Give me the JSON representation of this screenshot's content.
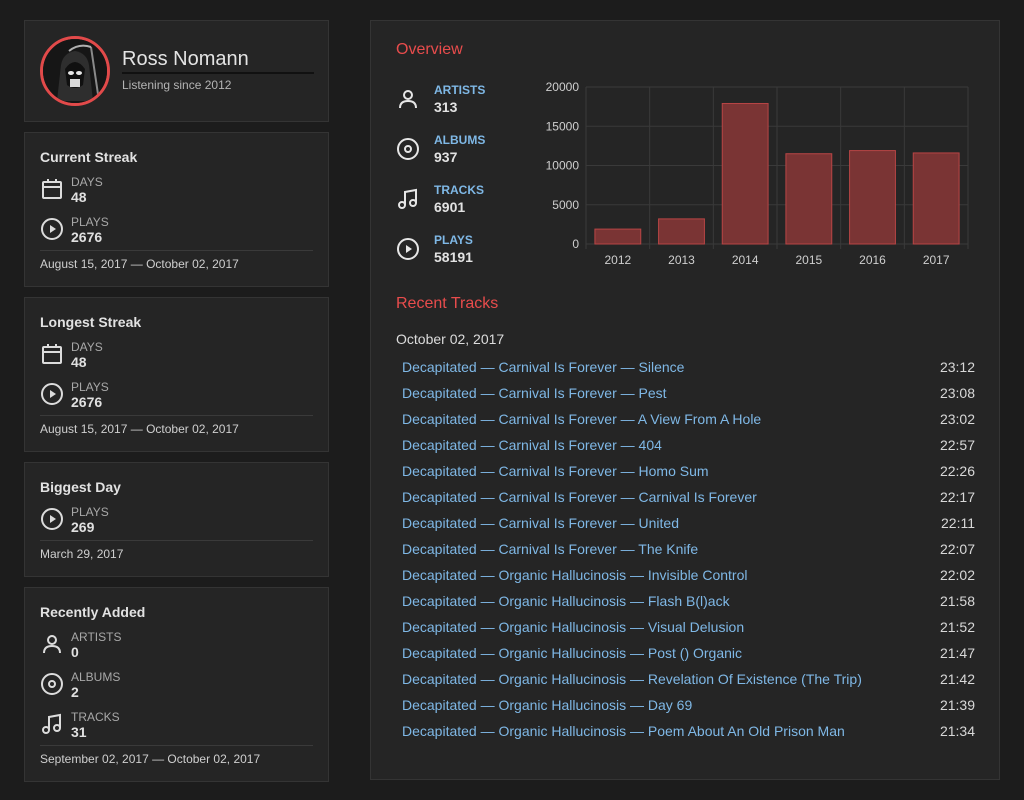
{
  "profile": {
    "name": "Ross Nomann",
    "since": "Listening since 2012"
  },
  "current_streak": {
    "title": "Current Streak",
    "days_label": "DAYS",
    "days": "48",
    "plays_label": "PLAYS",
    "plays": "2676",
    "range": "August 15, 2017 — October 02, 2017"
  },
  "longest_streak": {
    "title": "Longest Streak",
    "days_label": "DAYS",
    "days": "48",
    "plays_label": "PLAYS",
    "plays": "2676",
    "range": "August 15, 2017 — October 02, 2017"
  },
  "biggest_day": {
    "title": "Biggest Day",
    "plays_label": "PLAYS",
    "plays": "269",
    "date": "March 29, 2017"
  },
  "recently_added": {
    "title": "Recently Added",
    "artists_label": "ARTISTS",
    "artists": "0",
    "albums_label": "ALBUMS",
    "albums": "2",
    "tracks_label": "TRACKS",
    "tracks": "31",
    "range": "September 02, 2017 — October 02, 2017"
  },
  "overview": {
    "title": "Overview",
    "artists_label": "ARTISTS",
    "artists": "313",
    "albums_label": "ALBUMS",
    "albums": "937",
    "tracks_label": "TRACKS",
    "tracks": "6901",
    "plays_label": "PLAYS",
    "plays": "58191"
  },
  "chart_data": {
    "type": "bar",
    "categories": [
      "2012",
      "2013",
      "2014",
      "2015",
      "2016",
      "2017"
    ],
    "values": [
      1900,
      3200,
      17900,
      11500,
      11900,
      11600
    ],
    "ylim": [
      0,
      20000
    ],
    "yticks": [
      0,
      5000,
      10000,
      15000,
      20000
    ],
    "grid": true,
    "bar_color": "#7a3434",
    "bar_border": "#b84545"
  },
  "recent_tracks": {
    "title": "Recent Tracks",
    "date": "October 02, 2017",
    "items": [
      {
        "name": "Decapitated — Carnival Is Forever — Silence",
        "time": "23:12"
      },
      {
        "name": "Decapitated — Carnival Is Forever — Pest",
        "time": "23:08"
      },
      {
        "name": "Decapitated — Carnival Is Forever — A View From A Hole",
        "time": "23:02"
      },
      {
        "name": "Decapitated — Carnival Is Forever — 404",
        "time": "22:57"
      },
      {
        "name": "Decapitated — Carnival Is Forever — Homo Sum",
        "time": "22:26"
      },
      {
        "name": "Decapitated — Carnival Is Forever — Carnival Is Forever",
        "time": "22:17"
      },
      {
        "name": "Decapitated — Carnival Is Forever — United",
        "time": "22:11"
      },
      {
        "name": "Decapitated — Carnival Is Forever — The Knife",
        "time": "22:07"
      },
      {
        "name": "Decapitated — Organic Hallucinosis — Invisible Control",
        "time": "22:02"
      },
      {
        "name": "Decapitated — Organic Hallucinosis — Flash B(l)ack",
        "time": "21:58"
      },
      {
        "name": "Decapitated — Organic Hallucinosis — Visual Delusion",
        "time": "21:52"
      },
      {
        "name": "Decapitated — Organic Hallucinosis — Post () Organic",
        "time": "21:47"
      },
      {
        "name": "Decapitated — Organic Hallucinosis — Revelation Of Existence (The Trip)",
        "time": "21:42"
      },
      {
        "name": "Decapitated — Organic Hallucinosis — Day 69",
        "time": "21:39"
      },
      {
        "name": "Decapitated — Organic Hallucinosis — Poem About An Old Prison Man",
        "time": "21:34"
      }
    ]
  },
  "colors": {
    "accent": "#e84c4c",
    "link": "#7fb8e6",
    "card_bg": "#252525",
    "page_bg": "#1c1c1c"
  },
  "icons": {
    "artists": "person-icon",
    "albums": "disc-icon",
    "tracks": "music-note-icon",
    "plays": "play-circle-icon",
    "days": "calendar-icon"
  }
}
